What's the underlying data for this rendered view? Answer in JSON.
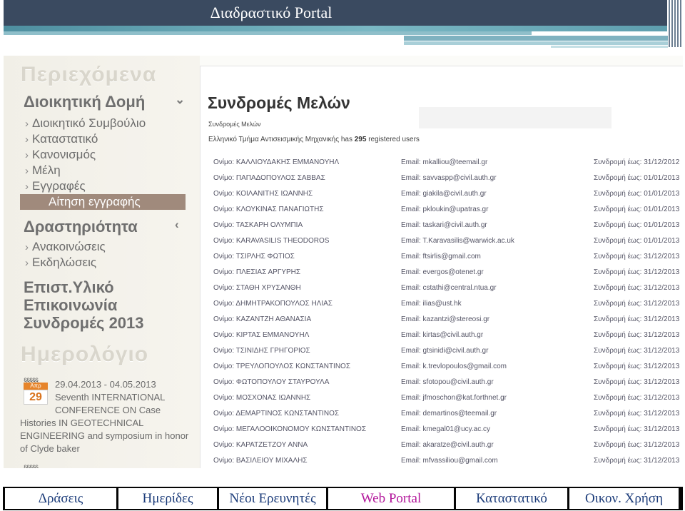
{
  "slide": {
    "title": "Διαδραστικό Portal"
  },
  "sidebar": {
    "heading_contents": "Περιεχόμενα",
    "section_admin": "Διοικητική Δομή",
    "admin_items": [
      "Διοικητικό Συμβούλιο",
      "Καταστατικό",
      "Κανονισμός",
      "Μέλη",
      "Εγγραφές"
    ],
    "active_item": "Αίτηση εγγραφής",
    "section_activity": "Δραστηριότητα",
    "activity_items": [
      "Ανακοινώσεις",
      "Εκδηλώσεις"
    ],
    "section_material": "Επιστ.Υλικό",
    "section_communication": "Επικοινωνία",
    "section_subscriptions": "Συνδρομές 2013",
    "heading_calendar": "Ημερολόγιο",
    "calendar_month": "Απρ",
    "calendar_day": "29",
    "event_lines": [
      "29.04.2013 - 04.05.2013",
      "Seventh INTERNATIONAL",
      "CONFERENCE ON Case",
      "Histories IN GEOTECHNICAL",
      "ENGINEERING and symposium in honor",
      "of Clyde baker"
    ]
  },
  "content": {
    "title": "Συνδρομές Μελών",
    "breadcrumb": "Συνδρομές Μελών",
    "summary_prefix": "Ελληνικό Τμήμα Αντισεισμικής Μηχανικής has",
    "summary_count": "295",
    "summary_suffix": "registered users",
    "members": [
      {
        "name": "Ονίμο: ΚΑΛΛΙΟΥΔΑΚΗΣ ΕΜΜΑΝΟΥΗΛ",
        "email": "Email: mkalliou@teemail.gr",
        "sub": "Συνδρομή έως: 31/12/2012"
      },
      {
        "name": "Ονίμο: ΠΑΠΑΔΟΠΟΥΛΟΣ ΣΑΒΒΑΣ",
        "email": "Email: savvaspp@civil.auth.gr",
        "sub": "Συνδρομή έως: 01/01/2013"
      },
      {
        "name": "Ονίμο: ΚΟΙΛΑΝΙΤΗΣ ΙΩΑΝΝΗΣ",
        "email": "Email: giakila@civil.auth.gr",
        "sub": "Συνδρομή έως: 01/01/2013"
      },
      {
        "name": "Ονίμο: ΚΛΟΥΚΙΝΑΣ ΠΑΝΑΓΙΩΤΗΣ",
        "email": "Email: pkloukin@upatras.gr",
        "sub": "Συνδρομή έως: 01/01/2013"
      },
      {
        "name": "Ονίμο: ΤΑΣΚΑΡΗ ΟΛΥΜΠΙΑ",
        "email": "Email: taskari@civil.auth.gr",
        "sub": "Συνδρομή έως: 01/01/2013"
      },
      {
        "name": "Ονίμο: KARAVASILIS THEODOROS",
        "email": "Email: T.Karavasilis@warwick.ac.uk",
        "sub": "Συνδρομή έως: 01/01/2013"
      },
      {
        "name": "Ονίμο: ΤΣΙΡΛΗΣ ΦΩΤΙΟΣ",
        "email": "Email: ftsirlis@gmail.com",
        "sub": "Συνδρομή έως: 31/12/2013"
      },
      {
        "name": "Ονίμο: ΠΛΕΣΙΑΣ ΑΡΓΥΡΗΣ",
        "email": "Email: evergos@otenet.gr",
        "sub": "Συνδρομή έως: 31/12/2013"
      },
      {
        "name": "Ονίμο: ΣΤΑΘΗ ΧΡΥΣΑΝΘΗ",
        "email": "Email: cstathi@central.ntua.gr",
        "sub": "Συνδρομή έως: 31/12/2013"
      },
      {
        "name": "Ονίμο: ΔΗΜΗΤΡΑΚΟΠΟΥΛΟΣ ΗΛΙΑΣ",
        "email": "Email: ilias@ust.hk",
        "sub": "Συνδρομή έως: 31/12/2013"
      },
      {
        "name": "Ονίμο: ΚΑΖΑΝΤΖΗ ΑΘΑΝΑΣΙΑ",
        "email": "Email: kazantzi@stereosi.gr",
        "sub": "Συνδρομή έως: 31/12/2013"
      },
      {
        "name": "Ονίμο: ΚΙΡΤΑΣ ΕΜΜΑΝΟΥΗΛ",
        "email": "Email: kirtas@civil.auth.gr",
        "sub": "Συνδρομή έως: 31/12/2013"
      },
      {
        "name": "Ονίμο: ΤΣΙΝΙΔΗΣ ΓΡΗΓΟΡΙΟΣ",
        "email": "Email: gtsinidi@civil.auth.gr",
        "sub": "Συνδρομή έως: 31/12/2013"
      },
      {
        "name": "Ονίμο: ΤΡΕΥΛΟΠΟΥΛΟΣ ΚΩΝΣΤΑΝΤΙΝΟΣ",
        "email": "Email: k.trevlopoulos@gmail.com",
        "sub": "Συνδρομή έως: 31/12/2013"
      },
      {
        "name": "Ονίμο: ΦΩΤΟΠΟΥΛΟΥ ΣΤΑΥΡΟΥΛΑ",
        "email": "Email: sfotopou@civil.auth.gr",
        "sub": "Συνδρομή έως: 31/12/2013"
      },
      {
        "name": "Ονίμο: ΜΟΣΧΟΝΑΣ ΙΩΑΝΝΗΣ",
        "email": "Email: jfmoschon@kat.forthnet.gr",
        "sub": "Συνδρομή έως: 31/12/2013"
      },
      {
        "name": "Ονίμο: ΔΕΜΑΡΤΙΝΟΣ ΚΩΝΣΤΑΝΤΙΝΟΣ",
        "email": "Email: demartinos@teemail.gr",
        "sub": "Συνδρομή έως: 31/12/2013"
      },
      {
        "name": "Ονίμο: ΜΕΓΑΛΟΟΙΚΟΝΟΜΟΥ ΚΩΝΣΤΑΝΤΙΝΟΣ",
        "email": "Email: kmegal01@ucy.ac.cy",
        "sub": "Συνδρομή έως: 31/12/2013"
      },
      {
        "name": "Ονίμο: ΚΑΡΑΤΖΕΤΖΟΥ ΑΝΝΑ",
        "email": "Email: akaratze@civil.auth.gr",
        "sub": "Συνδρομή έως: 31/12/2013"
      },
      {
        "name": "Ονίμο: ΒΑΣΙΛΕΙΟΥ ΜΙΧΑΛΗΣ",
        "email": "Email: mfvassiliou@gmail.com",
        "sub": "Συνδρομή έως: 31/12/2013"
      }
    ]
  },
  "bottom_nav": {
    "tabs": [
      "Δράσεις",
      "Ημερίδες",
      "Νέοι Ερευνητές",
      "Web Portal",
      "Καταστατικό",
      "Οικον. Χρήση"
    ],
    "active_tab": "Web Portal"
  }
}
